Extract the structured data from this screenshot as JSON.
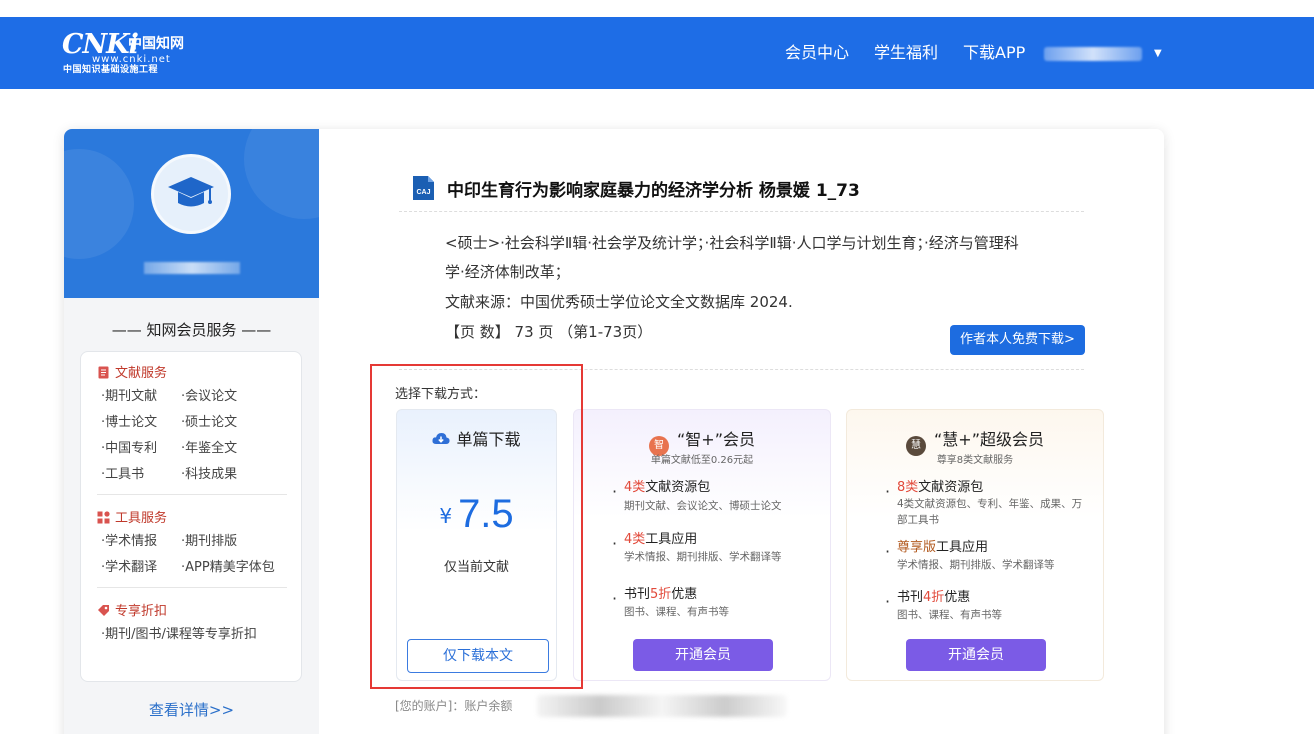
{
  "header": {
    "logo": {
      "brand": "CNKi",
      "brand_cn": "中国知网",
      "domain": "www.cnki.net",
      "tagline": "中国知识基础设施工程"
    },
    "nav": [
      "会员中心",
      "学生福利",
      "下载APP"
    ],
    "colors": {
      "bar": "#1e6de6"
    }
  },
  "sidebar": {
    "services_title": "—— 知网会员服务 ——",
    "groups": [
      {
        "icon": "document-icon",
        "title": "文献服务",
        "items": [
          "期刊文献",
          "会议论文",
          "博士论文",
          "硕士论文",
          "中国专利",
          "年鉴全文",
          "工具书",
          "科技成果"
        ]
      },
      {
        "icon": "tools-grid-icon",
        "title": "工具服务",
        "items": [
          "学术情报",
          "期刊排版",
          "学术翻译",
          "APP精美字体包"
        ]
      },
      {
        "icon": "tag-icon",
        "title": "专享折扣",
        "items": [
          "期刊/图书/课程等专享折扣"
        ]
      }
    ],
    "more": "查看详情>>"
  },
  "doc": {
    "file_type": "CAJ",
    "title": "中印生育行为影响家庭暴力的经济学分析 杨景媛 1_73",
    "category_line1": "<硕士>·社会科学Ⅱ辑·社会学及统计学；·社会科学Ⅱ辑·人口学与计划生育；·经济与管理科",
    "category_line2": "学·经济体制改革；",
    "source": "文献来源：中国优秀硕士学位论文全文数据库 2024.",
    "pages": "【页 数】 73 页 （第1-73页）",
    "author_free": "作者本人免费下载>"
  },
  "download": {
    "choose_label": "选择下载方式：",
    "single": {
      "icon": "cloud-download-icon",
      "title": "单篇下载",
      "currency": "¥",
      "price": "7.5",
      "desc": "仅当前文献",
      "button": "仅下载本文"
    },
    "zhi": {
      "badge": "智",
      "title": "“智+”会员",
      "subtitle": "单篇文献低至0.26元起",
      "features": [
        {
          "hl": "4类",
          "rest": "文献资源包",
          "sub": "期刊文献、会议论文、博硕士论文"
        },
        {
          "hl": "4类",
          "rest": "工具应用",
          "sub": "学术情报、期刊排版、学术翻译等"
        },
        {
          "pre": "书刊",
          "hl": "5折",
          "rest": "优惠",
          "sub": "图书、课程、有声书等"
        }
      ],
      "button": "开通会员"
    },
    "hui": {
      "badge": "慧",
      "title": "“慧+”超级会员",
      "subtitle": "尊享8类文献服务",
      "features": [
        {
          "hl": "8类",
          "rest": "文献资源包",
          "sub": "4类文献资源包、专利、年鉴、成果、万部工具书"
        },
        {
          "hl": "尊享版",
          "rest": "工具应用",
          "sub": "学术情报、期刊排版、学术翻译等"
        },
        {
          "pre": "书刊",
          "hl": "4折",
          "rest": "优惠",
          "sub": "图书、课程、有声书等"
        }
      ],
      "button": "开通会员"
    },
    "account": "[您的账户]：账户余额"
  },
  "colors": {
    "accent": "#1d6ce0",
    "vip_button": "#7b5be6",
    "highlight_red": "#e24a3b",
    "annotation_box": "#e53935"
  }
}
